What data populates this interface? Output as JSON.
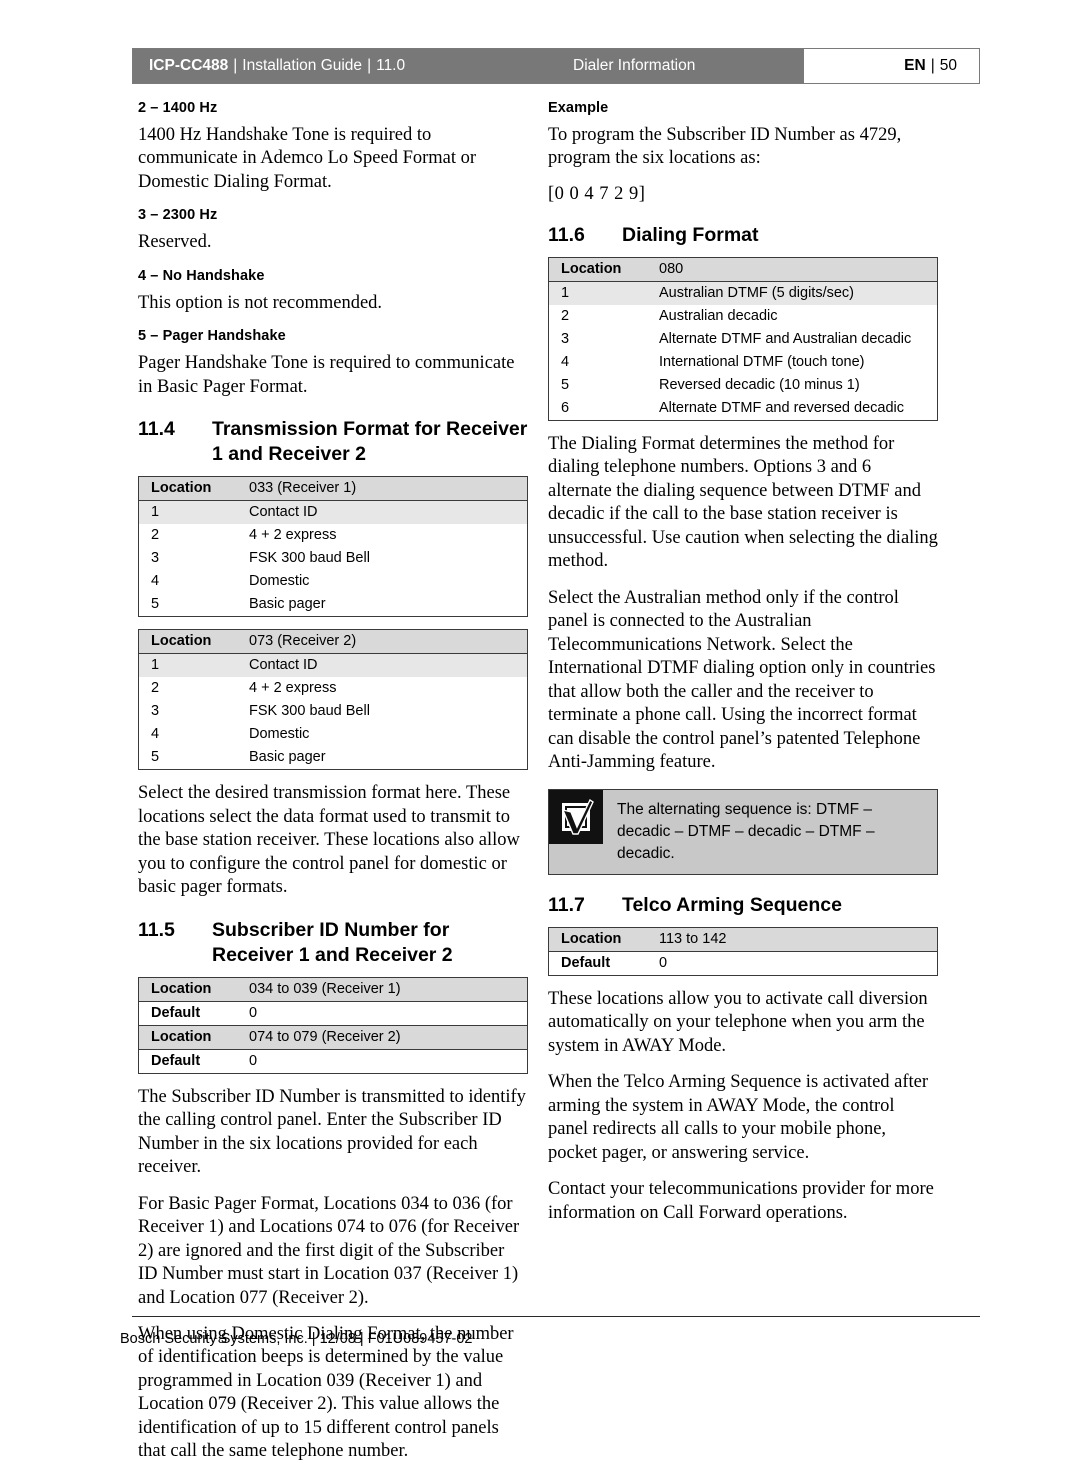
{
  "header": {
    "doc_id": "ICP-CC488",
    "separator": "|",
    "guide": "Installation Guide",
    "chapter": "11.0",
    "center_title": "Dialer Information",
    "lang": "EN",
    "page_number": "50"
  },
  "left_column": {
    "opt2_head": "2 – 1400 Hz",
    "opt2_body": "1400 Hz Handshake Tone is required to communicate in Ademco Lo Speed Format or Domestic Dialing Format.",
    "opt3_head": "3 – 2300 Hz",
    "opt3_body": "Reserved.",
    "opt4_head": "4 – No Handshake",
    "opt4_body": "This option is not recommended.",
    "opt5_head": "5 – Pager Handshake",
    "opt5_body": "Pager Handshake Tone is required to communicate in Basic Pager Format.",
    "s114": {
      "number": "11.4",
      "title": "Transmission Format for Receiver 1 and Receiver 2",
      "table_r1": {
        "header_key": "Location",
        "header_value": "033 (Receiver 1)",
        "rows": [
          {
            "index": "1",
            "label": "Contact ID",
            "shaded": true
          },
          {
            "index": "2",
            "label": "4 + 2 express",
            "shaded": false
          },
          {
            "index": "3",
            "label": "FSK 300 baud Bell",
            "shaded": false
          },
          {
            "index": "4",
            "label": "Domestic",
            "shaded": false
          },
          {
            "index": "5",
            "label": "Basic pager",
            "shaded": false
          }
        ]
      },
      "table_r2": {
        "header_key": "Location",
        "header_value": "073 (Receiver 2)",
        "rows": [
          {
            "index": "1",
            "label": "Contact ID",
            "shaded": true
          },
          {
            "index": "2",
            "label": "4 + 2 express",
            "shaded": false
          },
          {
            "index": "3",
            "label": "FSK 300 baud Bell",
            "shaded": false
          },
          {
            "index": "4",
            "label": "Domestic",
            "shaded": false
          },
          {
            "index": "5",
            "label": "Basic pager",
            "shaded": false
          }
        ]
      },
      "body": "Select the desired transmission format here. These locations select the data format used to transmit to the base station receiver. These locations also allow you to configure the control panel for domestic or basic pager formats."
    },
    "s115": {
      "number": "11.5",
      "title": "Subscriber ID Number for Receiver 1 and Receiver 2",
      "kv_rows": [
        {
          "key": "Location",
          "value": "034 to 039 (Receiver 1)",
          "shaded": true
        },
        {
          "key": "Default",
          "value": "0",
          "shaded": false
        },
        {
          "key": "Location",
          "value": "074 to 079 (Receiver 2)",
          "shaded": true
        },
        {
          "key": "Default",
          "value": "0",
          "shaded": false
        }
      ],
      "body1": "The Subscriber ID Number is transmitted to identify the calling control panel. Enter the Subscriber ID Number in the six locations provided for each receiver.",
      "body2": "For Basic Pager Format, Locations 034 to 036 (for Receiver 1) and Locations 074 to 076 (for Receiver 2) are ignored and the first digit of the Subscriber ID Number must start in Location 037 (Receiver 1) and Location 077 (Receiver 2).",
      "body3": "When using Domestic Dialing Format, the number of identification beeps is determined by the value programmed in Location 039 (Receiver 1) and Location 079 (Receiver 2). This value allows the identification of up to 15 different control panels that call the same telephone number."
    }
  },
  "right_column": {
    "example_head": "Example",
    "example_body": "To program the Subscriber ID Number as 4729, program the six locations as:",
    "example_code": "[0  0  4  7  2  9]",
    "s116": {
      "number": "11.6",
      "title": "Dialing Format",
      "table": {
        "header_key": "Location",
        "header_value": "080",
        "rows": [
          {
            "index": "1",
            "label": "Australian DTMF (5 digits/sec)",
            "shaded": true
          },
          {
            "index": "2",
            "label": "Australian decadic",
            "shaded": false
          },
          {
            "index": "3",
            "label": "Alternate DTMF and Australian decadic",
            "shaded": false
          },
          {
            "index": "4",
            "label": "International DTMF (touch tone)",
            "shaded": false
          },
          {
            "index": "5",
            "label": "Reversed decadic (10 minus 1)",
            "shaded": false
          },
          {
            "index": "6",
            "label": "Alternate DTMF and reversed decadic",
            "shaded": false
          }
        ]
      },
      "body1": "The Dialing Format determines the method for dialing telephone numbers. Options 3 and 6 alternate the dialing sequence between DTMF and decadic if the call to the base station receiver is unsuccessful. Use caution when selecting the dialing method.",
      "body2": "Select the Australian method only if the control panel is connected to the Australian Telecommunications Network. Select the International DTMF dialing option only in countries that allow both the caller and the receiver to terminate a phone call. Using the incorrect format can disable the control panel’s patented Telephone Anti-Jamming feature.",
      "note": "The alternating sequence is: DTMF – decadic – DTMF – decadic – DTMF – decadic."
    },
    "s117": {
      "number": "11.7",
      "title": "Telco Arming Sequence",
      "kv_rows": [
        {
          "key": "Location",
          "value": "113 to 142",
          "shaded": true
        },
        {
          "key": "Default",
          "value": "0",
          "shaded": false
        }
      ],
      "body1": "These locations allow you to activate call diversion automatically on your telephone when you arm the system in AWAY Mode.",
      "body2": "When the Telco Arming Sequence is activated after arming the system in AWAY Mode, the control panel redirects all calls to your mobile phone, pocket pager, or answering service.",
      "body3": "Contact your telecommunications provider for more information on Call Forward operations."
    }
  },
  "footer": {
    "text": "Bosch Security Systems, Inc. | 12/08 | F01U089457-02"
  },
  "colors": {
    "header_bar": "#787878",
    "table_header": "#d9d9d9",
    "row_shade": "#e7e7e7",
    "note_bg": "#c8c8c8",
    "note_icon_bg": "#111111",
    "rule": "#2a2a2a"
  },
  "icons": {
    "note": "checkbox-check-icon"
  }
}
